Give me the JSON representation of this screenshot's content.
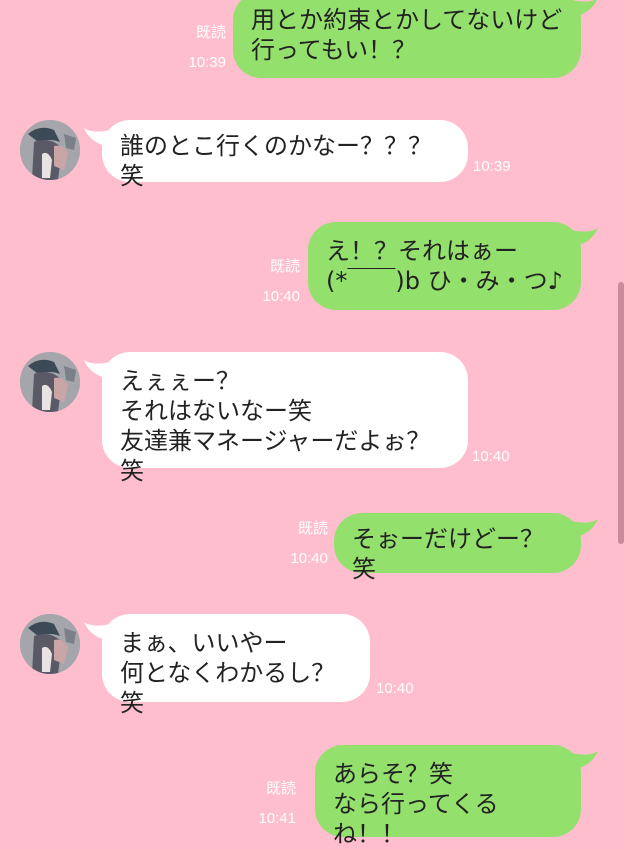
{
  "colors": {
    "background": "#ffbecd",
    "outgoing_bubble": "#94e06c",
    "incoming_bubble": "#ffffff",
    "meta_text": "#ffffff"
  },
  "messages": [
    {
      "dir": "out",
      "text": "用とか約束とかしてないけど\n行ってもい！？",
      "read": "既読",
      "time": "10:39"
    },
    {
      "dir": "in",
      "text": "誰のとこ行くのかなー？？？笑",
      "time": "10:39",
      "avatar": "avatar-icon"
    },
    {
      "dir": "out",
      "text": "え！？それはぁー\n(*￣￣)b ひ・み・つ♪",
      "read": "既読",
      "time": "10:40"
    },
    {
      "dir": "in",
      "text": "えぇぇー？\nそれはないなー笑\n友達兼マネージャーだよぉ？笑",
      "time": "10:40",
      "avatar": "avatar-icon"
    },
    {
      "dir": "out",
      "text": "そぉーだけどー？笑",
      "read": "既読",
      "time": "10:40"
    },
    {
      "dir": "in",
      "text": "まぁ、いいやー\n何となくわかるし？笑",
      "time": "10:40",
      "avatar": "avatar-icon"
    },
    {
      "dir": "out",
      "text": "あらそ？笑\nなら行ってくるね！！",
      "read": "既読",
      "time": "10:41"
    }
  ]
}
